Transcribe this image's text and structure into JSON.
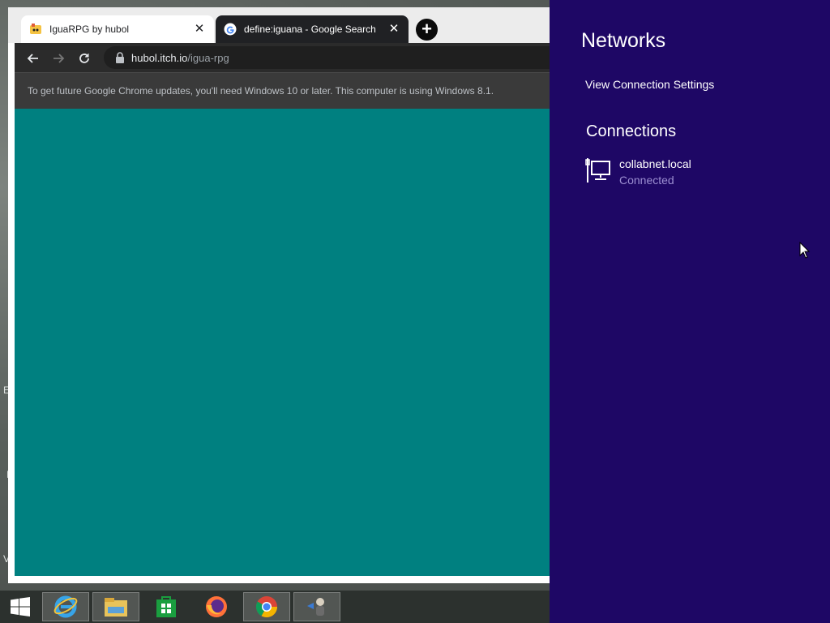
{
  "browser": {
    "tabs": [
      {
        "title": "IguaRPG by hubol",
        "active": true
      },
      {
        "title": "define:iguana - Google Search",
        "active": false
      }
    ],
    "address": {
      "host": "hubol.itch.io",
      "path": "/igua-rpg"
    },
    "infobar_text": "To get future Google Chrome updates, you'll need Windows 10 or later. This computer is using Windows 8.1.",
    "content_color": "#008080"
  },
  "panel": {
    "title": "Networks",
    "view_settings_label": "View Connection Settings",
    "connections_heading": "Connections",
    "connections": [
      {
        "name": "collabnet.local",
        "status": "Connected",
        "icon": "wired-network-icon"
      }
    ],
    "background": "#1e0765"
  },
  "desktop_letters": [
    "E",
    "I",
    "V"
  ],
  "taskbar": {
    "items": [
      "windows-start-icon",
      "internet-explorer-icon",
      "file-explorer-icon",
      "windows-store-icon",
      "firefox-icon",
      "chrome-icon",
      "remote-desktop-icon"
    ]
  }
}
